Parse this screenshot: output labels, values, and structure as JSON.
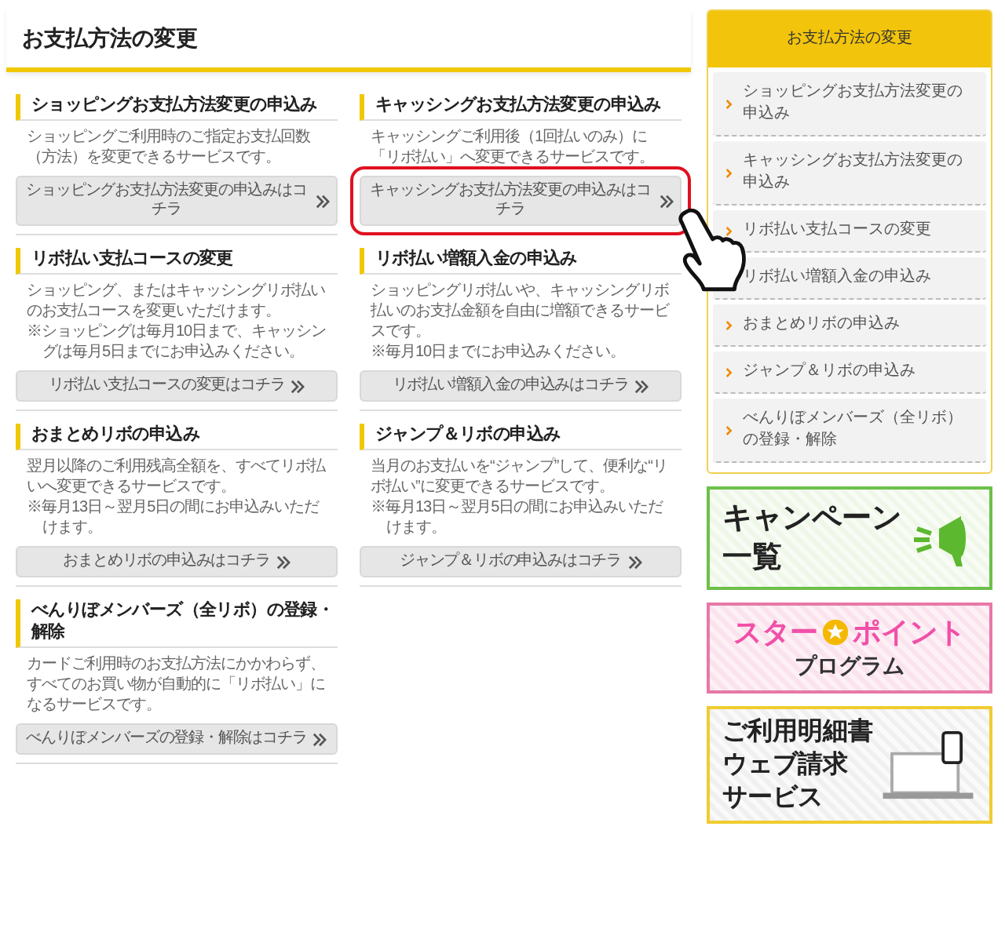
{
  "header": {
    "title": "お支払方法の変更"
  },
  "cards": [
    {
      "title": "ショッピングお支払方法変更の申込み",
      "description": "ショッピングご利用時のご指定お支払回数（方法）を変更できるサービスです。",
      "button": "ショッピングお支払方法変更の申込みはコチラ",
      "highlighted": false
    },
    {
      "title": "キャッシングお支払方法変更の申込み",
      "description": "キャッシングご利用後（1回払いのみ）に「リボ払い」へ変更できるサービスです。",
      "button": "キャッシングお支払方法変更の申込みはコチラ",
      "highlighted": true
    },
    {
      "title": "リボ払い支払コースの変更",
      "description": "ショッピング、またはキャッシングリボ払いのお支払コースを変更いただけます。",
      "notes": [
        "※ショッピングは毎月10日まで、キャッシングは毎月5日までにお申込みください。"
      ],
      "button": "リボ払い支払コースの変更はコチラ",
      "highlighted": false
    },
    {
      "title": "リボ払い増額入金の申込み",
      "description": "ショッピングリボ払いや、キャッシングリボ払いのお支払金額を自由に増額できるサービスです。",
      "notes": [
        "※毎月10日までにお申込みください。"
      ],
      "button": "リボ払い増額入金の申込みはコチラ",
      "highlighted": false
    },
    {
      "title": "おまとめリボの申込み",
      "description": "翌月以降のご利用残高全額を、すべてリボ払いへ変更できるサービスです。",
      "notes": [
        "※毎月13日～翌月5日の間にお申込みいただけます。"
      ],
      "button": "おまとめリボの申込みはコチラ",
      "highlighted": false
    },
    {
      "title": "ジャンプ＆リボの申込み",
      "description": "当月のお支払いを“ジャンプ”して、便利な“リボ払い”に変更できるサービスです。",
      "notes": [
        "※毎月13日～翌月5日の間にお申込みいただけます。"
      ],
      "button": "ジャンプ＆リボの申込みはコチラ",
      "highlighted": false
    },
    {
      "title": "べんりぼメンバーズ（全リボ）の登録・解除",
      "description": "カードご利用時のお支払方法にかかわらず、すべてのお買い物が自動的に「リボ払い」になるサービスです。",
      "button": "べんりぼメンバーズの登録・解除はコチラ",
      "highlighted": false
    }
  ],
  "sidebar": {
    "title": "お支払方法の変更",
    "items": [
      {
        "label": "ショッピングお支払方法変更の申込み"
      },
      {
        "label": "キャッシングお支払方法変更の申込み"
      },
      {
        "label": "リボ払い支払コースの変更"
      },
      {
        "label": "リボ払い増額入金の申込み"
      },
      {
        "label": "おまとめリボの申込み"
      },
      {
        "label": "ジャンプ＆リボの申込み"
      },
      {
        "label": "べんりぼメンバーズ（全リボ）の登録・解除"
      }
    ]
  },
  "banners": [
    {
      "kind": "campaign",
      "lines": [
        "キャンペーン",
        "一覧"
      ]
    },
    {
      "kind": "star",
      "lines": [
        "スター",
        "ポイント",
        "プログラム"
      ]
    },
    {
      "kind": "statement",
      "lines": [
        "ご利用明細書",
        "ウェブ請求",
        "サービス"
      ]
    }
  ]
}
